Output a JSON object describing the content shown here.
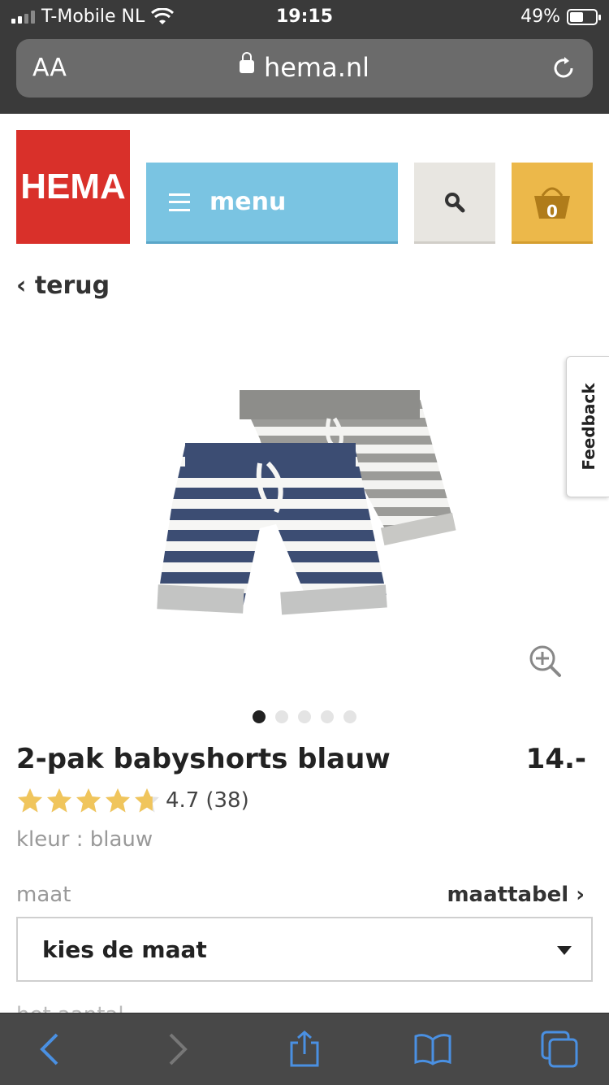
{
  "status_bar": {
    "carrier": "T-Mobile NL",
    "time": "19:15",
    "battery": "49%"
  },
  "browser": {
    "text_size_label": "AA",
    "url": "hema.nl"
  },
  "header": {
    "logo": "HEMA",
    "menu_label": "menu",
    "cart_count": "0"
  },
  "nav": {
    "back_label": "terug"
  },
  "feedback_label": "Feedback",
  "gallery": {
    "image_count": 5,
    "active_index": 0
  },
  "product": {
    "title": "2-pak babyshorts blauw",
    "price": "14.-",
    "rating_value": "4.7",
    "rating_count": "(38)",
    "stars_filled": 4.7,
    "color_line": "kleur : blauw"
  },
  "size": {
    "label": "maat",
    "chart_link": "maattabel",
    "select_placeholder": "kies de maat"
  },
  "cut_off_text": "het aantal",
  "colors": {
    "hema_red": "#d9302a",
    "menu_blue": "#7ac4e2",
    "cart_yellow": "#ecb84a",
    "star_gold": "#f0c55c",
    "toolbar_blue": "#4a90e2"
  }
}
